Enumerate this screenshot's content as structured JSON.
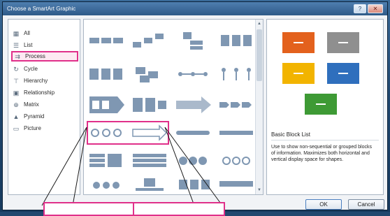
{
  "dialog": {
    "title": "Choose a SmartArt Graphic",
    "help_label": "?",
    "close_label": "✕"
  },
  "categories": [
    {
      "label": "All",
      "icon": "all-icon",
      "selected": false
    },
    {
      "label": "List",
      "icon": "list-icon",
      "selected": false
    },
    {
      "label": "Process",
      "icon": "process-icon",
      "selected": true
    },
    {
      "label": "Cycle",
      "icon": "cycle-icon",
      "selected": false
    },
    {
      "label": "Hierarchy",
      "icon": "hierarchy-icon",
      "selected": false
    },
    {
      "label": "Relationship",
      "icon": "relationship-icon",
      "selected": false
    },
    {
      "label": "Matrix",
      "icon": "matrix-icon",
      "selected": false
    },
    {
      "label": "Pyramid",
      "icon": "pyramid-icon",
      "selected": false
    },
    {
      "label": "Picture",
      "icon": "picture-icon",
      "selected": false
    }
  ],
  "preview": {
    "title": "Basic Block List",
    "description": "Use to show non-sequential or grouped blocks of information. Maximizes both horizontal and vertical display space for shapes.",
    "block_colors": [
      "#e3611d",
      "#8f8f8f",
      "#f2b400",
      "#2f6fbd",
      "#3e9a35"
    ]
  },
  "buttons": {
    "ok": "OK",
    "cancel": "Cancel"
  },
  "colors": {
    "highlight": "#e0308a",
    "thumbnail": "#5a7fa8"
  }
}
